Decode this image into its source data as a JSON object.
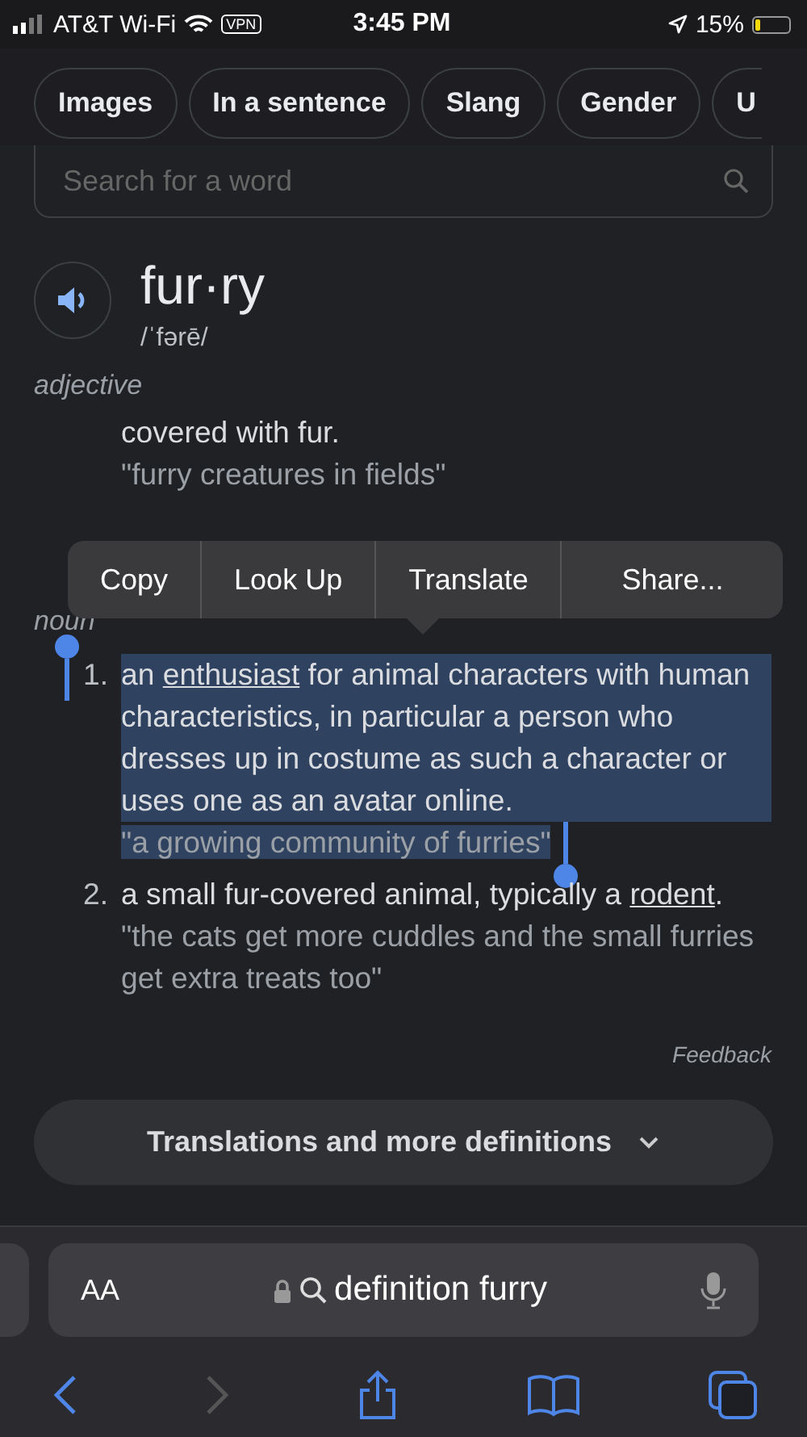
{
  "status_bar": {
    "carrier": "AT&T Wi-Fi",
    "vpn": "VPN",
    "time": "3:45 PM",
    "battery": "15%"
  },
  "chips": [
    {
      "label": "Images"
    },
    {
      "label": "In a sentence"
    },
    {
      "label": "Slang"
    },
    {
      "label": "Gender"
    },
    {
      "label": "U"
    }
  ],
  "search": {
    "placeholder": "Search for a word"
  },
  "entry": {
    "word": "fur·ry",
    "pronunciation": "/ˈfərē/",
    "senses": [
      {
        "pos": "adjective",
        "definitions": [
          {
            "selected": false,
            "segments": [
              {
                "text": "covered with fur.",
                "link": false
              }
            ],
            "example": "\"furry creatures in fields\""
          }
        ]
      },
      {
        "pos": "noun",
        "definitions": [
          {
            "number": "1.",
            "selected": true,
            "segments": [
              {
                "text": "an ",
                "link": false
              },
              {
                "text": "enthusiast",
                "link": true
              },
              {
                "text": " for animal characters with human characteristics, in particular a person who dresses up in costume as such a character or uses one as an avatar online.",
                "link": false
              }
            ],
            "example": "\"a growing community of furries\""
          },
          {
            "number": "2.",
            "selected": false,
            "segments": [
              {
                "text": "a small fur-covered animal, typically a ",
                "link": false
              },
              {
                "text": "rodent",
                "link": true
              },
              {
                "text": ".",
                "link": false
              }
            ],
            "example": "\"the cats get more cuddles and the small furries get extra treats too\""
          }
        ]
      }
    ]
  },
  "context_menu": [
    "Copy",
    "Look Up",
    "Translate",
    "Share..."
  ],
  "feedback": "Feedback",
  "more_button": "Translations and more definitions",
  "browser": {
    "text_size": "AA",
    "url": "definition furry",
    "forward_disabled": true
  }
}
